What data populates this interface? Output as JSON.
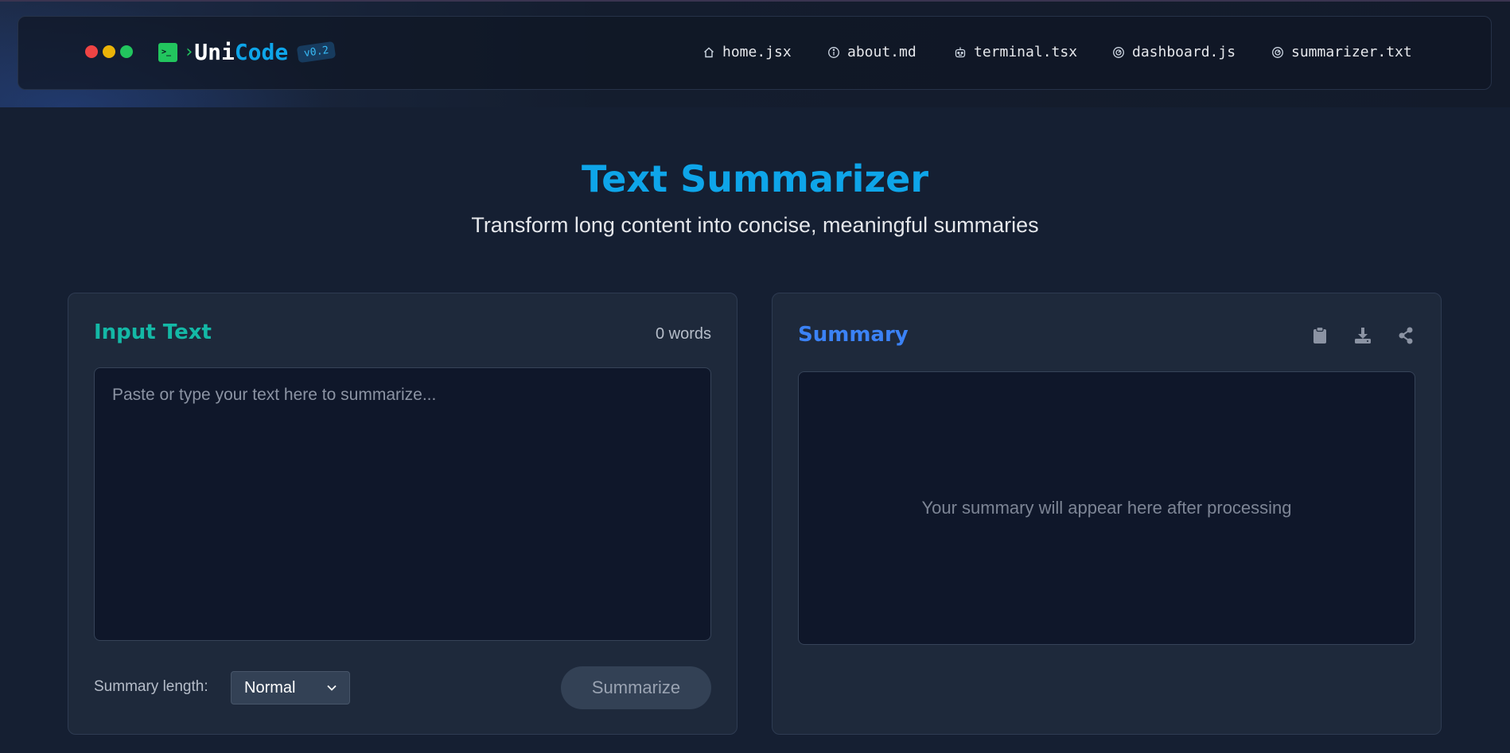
{
  "header": {
    "brand_prefix": "Uni",
    "brand_suffix": "Code",
    "version": "v0.2",
    "nav": [
      {
        "label": "home.jsx",
        "icon": "home-icon"
      },
      {
        "label": "about.md",
        "icon": "info-icon"
      },
      {
        "label": "terminal.tsx",
        "icon": "robot-icon"
      },
      {
        "label": "dashboard.js",
        "icon": "gauge-icon"
      },
      {
        "label": "summarizer.txt",
        "icon": "gauge-icon"
      }
    ]
  },
  "hero": {
    "title": "Text Summarizer",
    "subtitle": "Transform long content into concise, meaningful summaries"
  },
  "input_panel": {
    "title": "Input Text",
    "word_count": "0 words",
    "placeholder": "Paste or type your text here to summarize...",
    "length_label": "Summary length:",
    "length_value": "Normal",
    "button_label": "Summarize"
  },
  "summary_panel": {
    "title": "Summary",
    "placeholder": "Your summary will appear here after processing",
    "actions": [
      "clipboard-icon",
      "download-icon",
      "share-icon"
    ]
  },
  "colors": {
    "accent": "#0ea5e9",
    "input_title": "#14b8a6",
    "summary_title": "#3b82f6",
    "terminal_green": "#22c55e"
  }
}
